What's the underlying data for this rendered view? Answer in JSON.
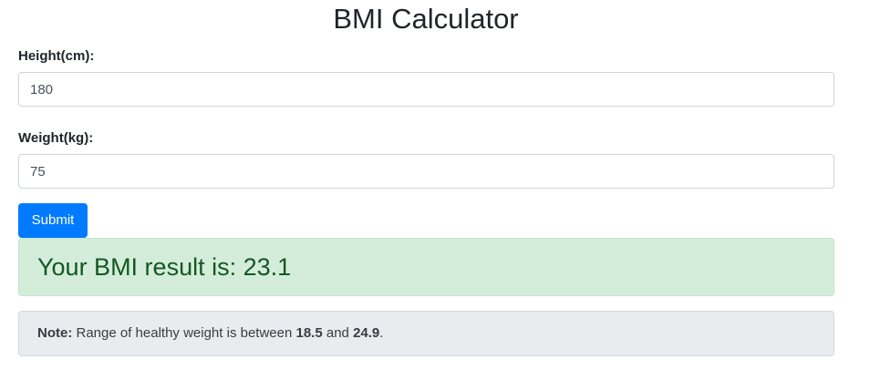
{
  "page": {
    "title": "BMI Calculator"
  },
  "form": {
    "height": {
      "label": "Height(cm):",
      "value": "180"
    },
    "weight": {
      "label": "Weight(kg):",
      "value": "75"
    },
    "submit_label": "Submit"
  },
  "result": {
    "prefix": "Your BMI result is: ",
    "value": "23.1"
  },
  "note": {
    "label": "Note:",
    "text_before": " Range of healthy weight is between ",
    "low": "18.5",
    "text_middle": " and ",
    "high": "24.9",
    "text_after": "."
  },
  "colors": {
    "primary": "#007bff",
    "success_bg": "#d4edda",
    "success_text": "#155724",
    "note_bg": "#e9ecef"
  }
}
